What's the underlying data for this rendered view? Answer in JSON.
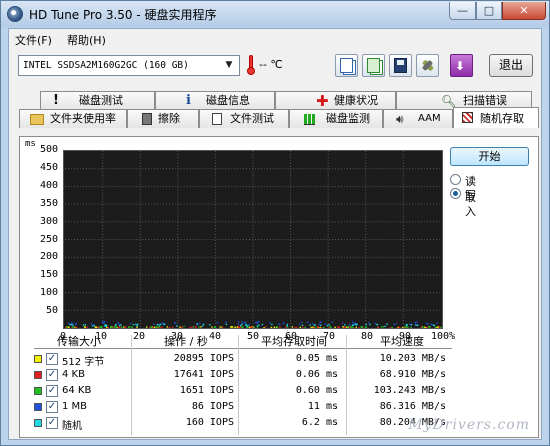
{
  "window": {
    "title": "HD Tune Pro 3.50 - 硬盘实用程序"
  },
  "menu": {
    "file": "文件(F)",
    "help": "帮助(H)"
  },
  "toolbar": {
    "drive": "INTEL SSDSA2M160G2GC (160 GB)",
    "temperature": "-- ℃",
    "exit_label": "退出"
  },
  "tabs_top": [
    {
      "label": "磁盘测试",
      "icon": "exclamation-icon"
    },
    {
      "label": "磁盘信息",
      "icon": "info-icon"
    },
    {
      "label": "健康状况",
      "icon": "red-cross-icon"
    },
    {
      "label": "扫描错误",
      "icon": "magnifier-icon"
    }
  ],
  "tabs_bottom": [
    {
      "label": "文件夹使用率",
      "icon": "folder-icon"
    },
    {
      "label": "擦除",
      "icon": "trash-icon"
    },
    {
      "label": "文件测试",
      "icon": "file-icon"
    },
    {
      "label": "磁盘监测",
      "icon": "bar-chart-icon"
    },
    {
      "label": "AAM",
      "icon": "speaker-icon"
    },
    {
      "label": "随机存取",
      "icon": "random-access-icon",
      "active": true
    }
  ],
  "controls": {
    "start_label": "开始",
    "read_label": "读取",
    "write_label": "写入",
    "selected": "write"
  },
  "chart_data": {
    "type": "scatter",
    "ylabel": "ms",
    "yticks": [
      "500",
      "450",
      "400",
      "350",
      "300",
      "250",
      "200",
      "150",
      "100",
      "50"
    ],
    "xticks": [
      "0",
      "10",
      "20",
      "30",
      "40",
      "50",
      "60",
      "70",
      "80",
      "90",
      "100%"
    ],
    "ylim": [
      0,
      500
    ],
    "xlim": [
      0,
      100
    ],
    "grid": true,
    "note": "all points clustered near 0-6 ms across full 0-100% range",
    "series": [
      {
        "name": "512 字节",
        "color": "#f2f200",
        "level_ms": 0.05
      },
      {
        "name": "4 KB",
        "color": "#e02020",
        "level_ms": 0.06
      },
      {
        "name": "64 KB",
        "color": "#20c020",
        "level_ms": 0.6
      },
      {
        "name": "1 MB",
        "color": "#2050e0",
        "level_ms": 11
      },
      {
        "name": "随机",
        "color": "#20d8e0",
        "level_ms": 6.2
      }
    ]
  },
  "table": {
    "headers": [
      "传输大小",
      "操作 / 秒",
      "平均存取时间",
      "平均速度"
    ],
    "rows": [
      {
        "name": "512 字节",
        "color": "#f2f200",
        "checked": "✓",
        "ops": "20895 IOPS",
        "access": "0.05 ms",
        "speed": "10.203 MB/s"
      },
      {
        "name": "4 KB",
        "color": "#e02020",
        "checked": "✓",
        "ops": "17641 IOPS",
        "access": "0.06 ms",
        "speed": "68.910 MB/s"
      },
      {
        "name": "64 KB",
        "color": "#20c020",
        "checked": "✓",
        "ops": "1651 IOPS",
        "access": "0.60 ms",
        "speed": "103.243 MB/s"
      },
      {
        "name": "1 MB",
        "color": "#2050e0",
        "checked": "✓",
        "ops": "86 IOPS",
        "access": "11 ms",
        "speed": "86.316 MB/s"
      },
      {
        "name": "随机",
        "color": "#20d8e0",
        "checked": "✓",
        "ops": "160 IOPS",
        "access": "6.2 ms",
        "speed": "80.204 MB/s"
      }
    ]
  },
  "watermark": "MyDrivers.com"
}
